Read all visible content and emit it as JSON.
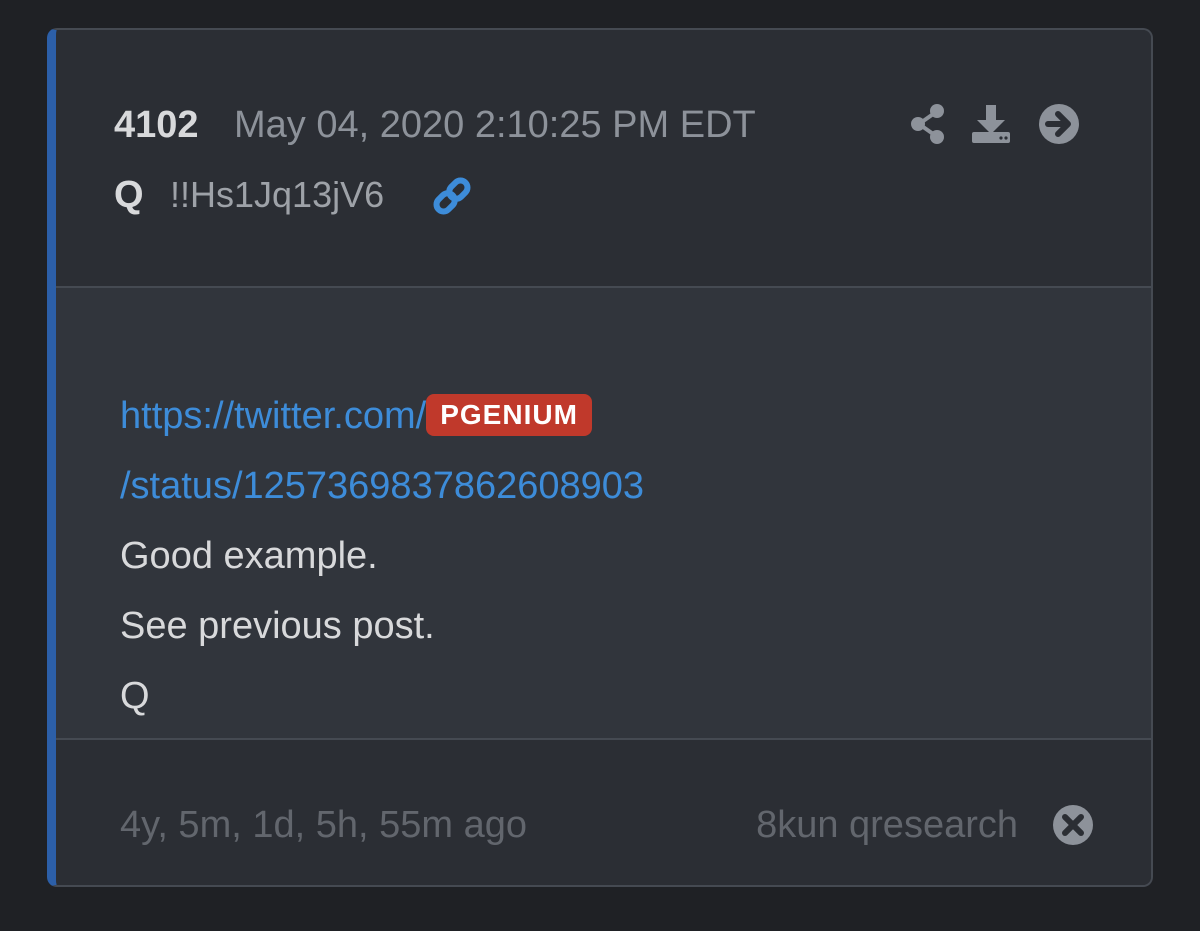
{
  "post": {
    "number": "4102",
    "timestamp": "May 04, 2020 2:10:25 PM EDT",
    "author": "Q",
    "tripcode": "!!Hs1Jq13jV6"
  },
  "header_icons": [
    "share-icon",
    "download-icon",
    "arrow-right-icon"
  ],
  "body": {
    "link_part1": "https://twitter.com/",
    "link_badge": "PGENIUM",
    "link_part2": "/status/1257369837862608903",
    "lines": [
      "Good example.",
      "See previous post.",
      "Q"
    ]
  },
  "footer": {
    "ago": "4y, 5m, 1d, 5h, 55m ago",
    "source": "8kun qresearch"
  },
  "colors": {
    "accent": "#2c5fa8",
    "link": "#3d8cd9",
    "badge": "#c0392b",
    "card_bg": "#2b2e34",
    "body_bg": "#31353c",
    "page_bg": "#1f2125"
  }
}
